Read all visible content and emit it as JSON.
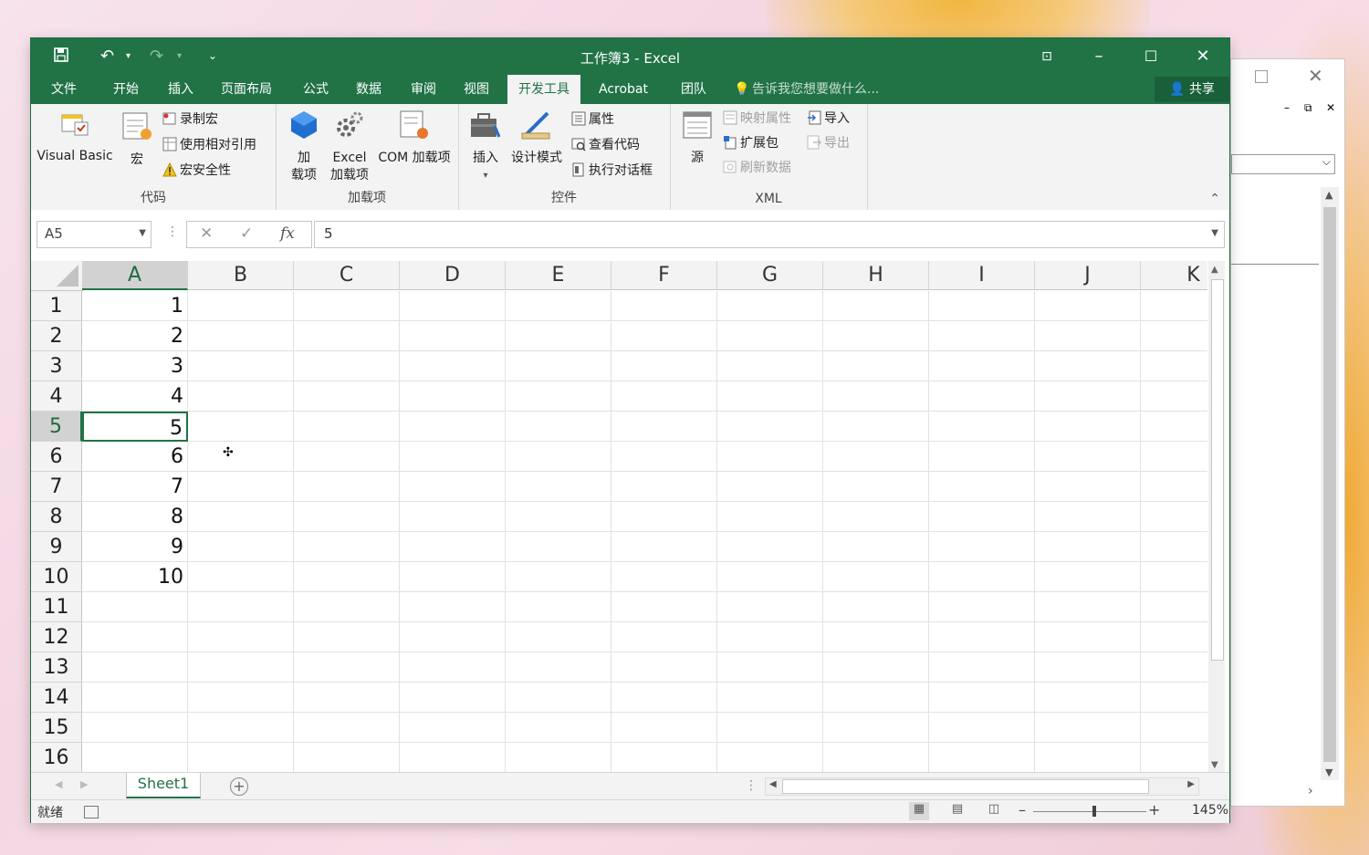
{
  "window_title": "工作簿3 - Excel",
  "ribbon_tabs": [
    "文件",
    "开始",
    "插入",
    "页面布局",
    "公式",
    "数据",
    "审阅",
    "视图",
    "开发工具",
    "Acrobat",
    "团队"
  ],
  "active_tab": "开发工具",
  "tell_me": "告诉我您想要做什么...",
  "share_label": "共享",
  "groups": {
    "code": {
      "label": "代码",
      "visual_basic": "Visual Basic",
      "macros": "宏",
      "record_macro": "录制宏",
      "relative_ref": "使用相对引用",
      "macro_security": "宏安全性"
    },
    "addins": {
      "label": "加载项",
      "addins_line1": "加",
      "addins_line2": "载项",
      "excel_addins_line1": "Excel",
      "excel_addins_line2": "加载项",
      "com_addins": "COM 加载项"
    },
    "controls": {
      "label": "控件",
      "insert": "插入",
      "design_mode": "设计模式",
      "properties": "属性",
      "view_code": "查看代码",
      "run_dialog": "执行对话框"
    },
    "xml": {
      "label": "XML",
      "source": "源",
      "map_properties": "映射属性",
      "expansion_packs": "扩展包",
      "refresh_data": "刷新数据",
      "import": "导入",
      "export": "导出"
    }
  },
  "formula_bar": {
    "name_box": "A5",
    "fx": "fx",
    "value": "5"
  },
  "columns": [
    "A",
    "B",
    "C",
    "D",
    "E",
    "F",
    "G",
    "H",
    "I",
    "J",
    "K"
  ],
  "rows": [
    "1",
    "2",
    "3",
    "4",
    "5",
    "6",
    "7",
    "8",
    "9",
    "10",
    "11",
    "12",
    "13",
    "14",
    "15",
    "16"
  ],
  "col_a_values": [
    "1",
    "2",
    "3",
    "4",
    "5",
    "6",
    "7",
    "8",
    "9",
    "10"
  ],
  "selected_cell": "A5",
  "sheet_tab": "Sheet1",
  "status": "就绪",
  "zoom": "145%",
  "colors": {
    "excel_green": "#217346",
    "ribbon_bg": "#f3f3f3"
  }
}
